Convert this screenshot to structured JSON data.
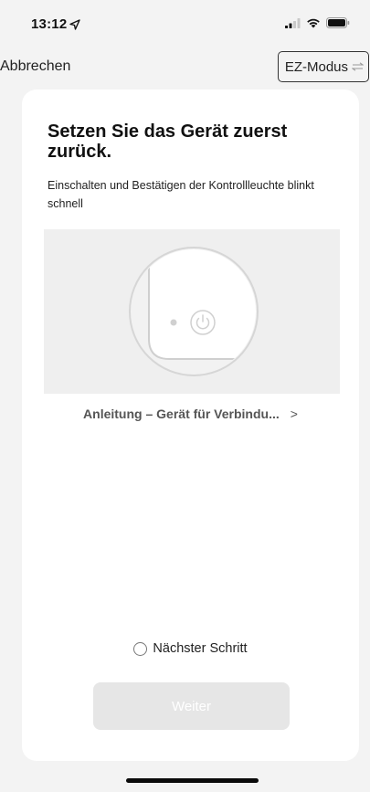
{
  "status_bar": {
    "time": "13:12",
    "icons": [
      "location-arrow-icon",
      "cellular-signal-icon",
      "wifi-icon",
      "battery-icon"
    ]
  },
  "nav": {
    "cancel_label": "Abbrechen",
    "mode_label": "EZ-Modus",
    "mode_icon": "switch-arrows-icon"
  },
  "card": {
    "title": "Setzen Sie das Gerät zuerst zurück.",
    "subtitle": "Einschalten und Bestätigen der Kontrollleuchte blinkt schnell",
    "illustration_icon": "power-button-icon",
    "guide_link": "Anleitung – Gerät für Verbindu...",
    "guide_chevron": ">",
    "next_step_label": "Nächster Schritt",
    "next_step_checked": false,
    "continue_label": "Weiter"
  },
  "colors": {
    "background": "#f3f3f3",
    "card": "#ffffff",
    "button_disabled": "#e6e6e6",
    "illustration_bg": "#efefef"
  }
}
